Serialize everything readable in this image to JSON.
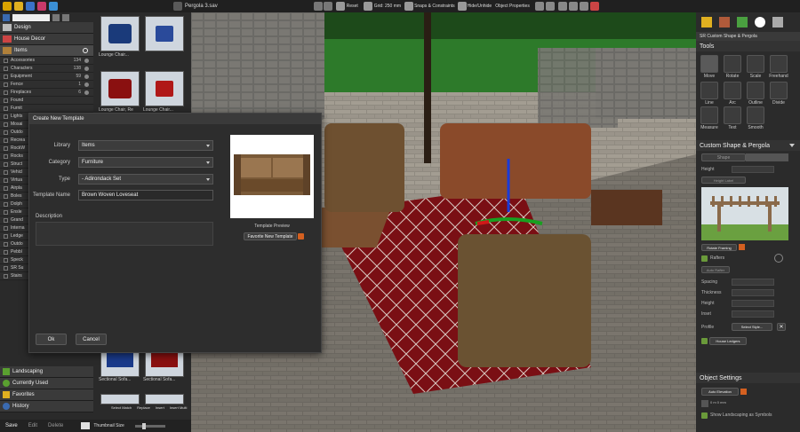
{
  "window": {
    "title": "Pergola 3.sav"
  },
  "toolbar": {
    "reset": "Reset",
    "grid": "Grid: 250 mm",
    "snaps": "Snaps & Constraints",
    "hide_unhide": "Hide/Unhide",
    "object_properties": "Object Properties"
  },
  "left": {
    "categories": [
      {
        "label": "Design"
      },
      {
        "label": "House Decor"
      },
      {
        "label": "Items"
      }
    ],
    "items": [
      {
        "label": "Accessories",
        "count": "134"
      },
      {
        "label": "Characters",
        "count": "138"
      },
      {
        "label": "Equipment",
        "count": "59"
      },
      {
        "label": "Fence",
        "count": "1"
      },
      {
        "label": "Fireplaces",
        "count": "6"
      },
      {
        "label": "Found"
      },
      {
        "label": "Furnit"
      },
      {
        "label": "Lights"
      },
      {
        "label": "Mosai"
      },
      {
        "label": "Outdo"
      },
      {
        "label": "Recrea"
      },
      {
        "label": "RockW"
      },
      {
        "label": "Rocks"
      },
      {
        "label": "Struct"
      },
      {
        "label": "Vehicl"
      },
      {
        "label": "Virtua"
      },
      {
        "label": "Airpla"
      },
      {
        "label": "Boles"
      },
      {
        "label": "Dolph"
      },
      {
        "label": "Ensle"
      },
      {
        "label": "Grand"
      },
      {
        "label": "Interna"
      },
      {
        "label": "Ledge"
      },
      {
        "label": "Outdo"
      },
      {
        "label": "Pebbl"
      },
      {
        "label": "Speck"
      },
      {
        "label": "SR Su"
      },
      {
        "label": "Stairs"
      }
    ],
    "thumbs": [
      {
        "label": "Lounge Chair..."
      },
      {
        "label": ""
      },
      {
        "label": "Lounge Chair, Re"
      },
      {
        "label": "Lounge Chair..."
      },
      {
        "label": "Sectional Sofa..."
      },
      {
        "label": "Sectional Sofa..."
      },
      {
        "label": ""
      },
      {
        "label": ""
      }
    ],
    "sections": [
      {
        "label": "Landscaping"
      },
      {
        "label": "Currently Used"
      },
      {
        "label": "Favorites"
      },
      {
        "label": "History"
      }
    ],
    "mini_tools": [
      "Select Match",
      "Replace",
      "Insert",
      "Insert Multi"
    ],
    "bottom": {
      "save": "Save",
      "edit": "Edit",
      "delete": "Delete",
      "thumb_size": "Thumbnail Size"
    }
  },
  "dialog": {
    "title": "Create New Template",
    "library_label": "Library",
    "library_value": "Items",
    "category_label": "Category",
    "category_value": "Furniture",
    "type_label": "Type",
    "type_value": "- Adirondack Set",
    "name_label": "Template Name",
    "name_value": "Brown Woven Loveseat",
    "description_label": "Description",
    "preview_label": "Template Preview",
    "favorite_label": "Favorite New Template",
    "ok": "Ok",
    "cancel": "Cancel"
  },
  "right": {
    "breadcrumb": "SR Custom Shape & Pergola",
    "tools_title": "Tools",
    "tools": [
      {
        "label": "Move"
      },
      {
        "label": "Rotate"
      },
      {
        "label": "Scale"
      },
      {
        "label": "Freehand"
      },
      {
        "label": "Line"
      },
      {
        "label": "Arc"
      },
      {
        "label": "Outline"
      },
      {
        "label": "Divide"
      },
      {
        "label": "Measure"
      },
      {
        "label": "Text"
      },
      {
        "label": "Smooth"
      }
    ],
    "panel_title": "Custom Shape & Pergola",
    "shape_tab": "Shape",
    "height_label": "Height",
    "height_label_btn": "Height Label",
    "rotate_framing": "Rotate Framing",
    "rafters": "Rafters",
    "auto_rafter": "Auto Rafter",
    "props": [
      {
        "label": "Spacing"
      },
      {
        "label": "Thickness"
      },
      {
        "label": "Height"
      },
      {
        "label": "Inset"
      }
    ],
    "profile_label": "Profile",
    "select_style": "Select Style...",
    "house_ledgers": "House Ledgers",
    "object_settings_title": "Object Settings",
    "auto_elevation": "Auto Elevation",
    "elev_value": "0 m  0 mm",
    "show_landscaping": "Show Landscaping as Symbols"
  }
}
